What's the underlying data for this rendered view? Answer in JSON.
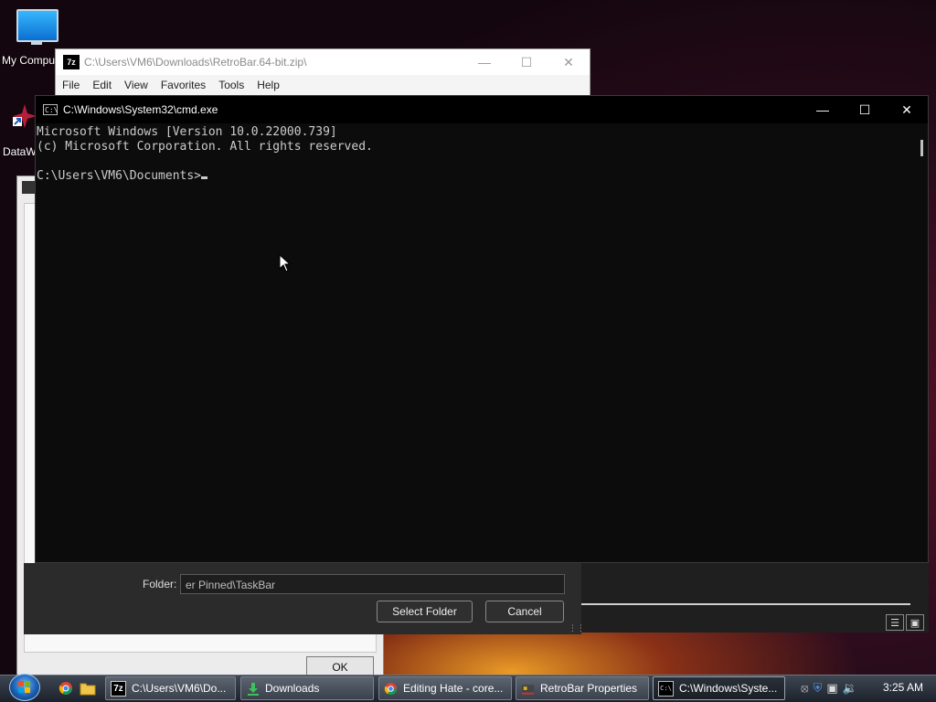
{
  "desktop": {
    "icons": [
      {
        "label": "My Compu",
        "icon": "computer-icon"
      },
      {
        "label": "DataW",
        "icon": "datawrapper-icon"
      }
    ]
  },
  "zip_window": {
    "title": "C:\\Users\\VM6\\Downloads\\RetroBar.64-bit.zip\\",
    "logo": "7z",
    "menu": [
      "File",
      "Edit",
      "View",
      "Favorites",
      "Tools",
      "Help"
    ]
  },
  "cmd_window": {
    "title": "C:\\Windows\\System32\\cmd.exe",
    "icon_text": "C:\\",
    "lines": [
      "Microsoft Windows [Version 10.0.22000.739]",
      "(c) Microsoft Corporation. All rights reserved.",
      "",
      "C:\\Users\\VM6\\Documents>"
    ]
  },
  "folder_dialog": {
    "label": "Folder:",
    "value": "er Pinned\\TaskBar",
    "select_label": "Select Folder",
    "cancel_label": "Cancel"
  },
  "background_dialog": {
    "ok_label": "OK"
  },
  "taskbar": {
    "items": [
      {
        "label": "C:\\Users\\VM6\\Do...",
        "icon": "7zip-icon"
      },
      {
        "label": "Downloads",
        "icon": "download-icon"
      },
      {
        "label": "Editing Hate - core...",
        "icon": "chrome-icon"
      },
      {
        "label": "RetroBar Properties",
        "icon": "retrobar-icon"
      },
      {
        "label": "C:\\Windows\\Syste...",
        "icon": "cmd-icon",
        "active": true
      }
    ],
    "clock": "3:25 AM"
  },
  "colors": {
    "cmd_bg": "#0c0c0c",
    "cmd_text": "#cccccc",
    "taskbar": "#2b323c"
  }
}
